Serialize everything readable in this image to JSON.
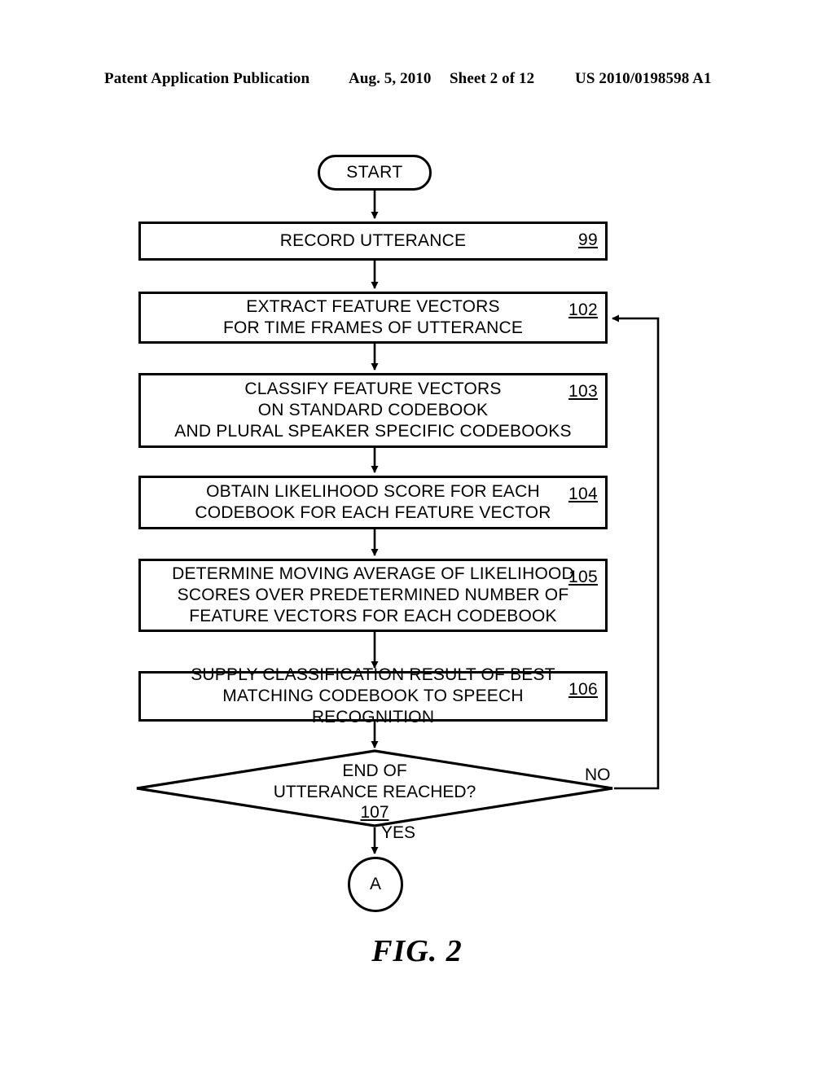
{
  "header": {
    "publication": "Patent Application Publication",
    "date": "Aug. 5, 2010",
    "sheet": "Sheet 2 of 12",
    "number": "US 2010/0198598 A1"
  },
  "figure": {
    "caption": "FIG. 2"
  },
  "flow": {
    "start": {
      "label": "START"
    },
    "steps": [
      {
        "id": "99",
        "ref": "99",
        "text": "RECORD UTTERANCE"
      },
      {
        "id": "102",
        "ref": "102",
        "text": "EXTRACT FEATURE VECTORS\nFOR TIME FRAMES OF UTTERANCE"
      },
      {
        "id": "103",
        "ref": "103",
        "text": "CLASSIFY FEATURE VECTORS\nON STANDARD CODEBOOK\nAND PLURAL SPEAKER SPECIFIC CODEBOOKS"
      },
      {
        "id": "104",
        "ref": "104",
        "text": "OBTAIN LIKELIHOOD SCORE FOR EACH\nCODEBOOK FOR EACH FEATURE VECTOR"
      },
      {
        "id": "105",
        "ref": "105",
        "text": "DETERMINE MOVING AVERAGE OF LIKELIHOOD\nSCORES OVER PREDETERMINED NUMBER OF\nFEATURE VECTORS FOR EACH CODEBOOK"
      },
      {
        "id": "106",
        "ref": "106",
        "text": "SUPPLY CLASSIFICATION RESULT OF BEST\nMATCHING CODEBOOK TO SPEECH RECOGNITION"
      }
    ],
    "decision": {
      "id": "107",
      "ref": "107",
      "text": "END OF\nUTTERANCE REACHED?",
      "branch_no": "NO",
      "branch_yes": "YES"
    },
    "connector": {
      "label": "A"
    }
  },
  "colors": {
    "stroke": "#000000",
    "background": "#ffffff"
  }
}
